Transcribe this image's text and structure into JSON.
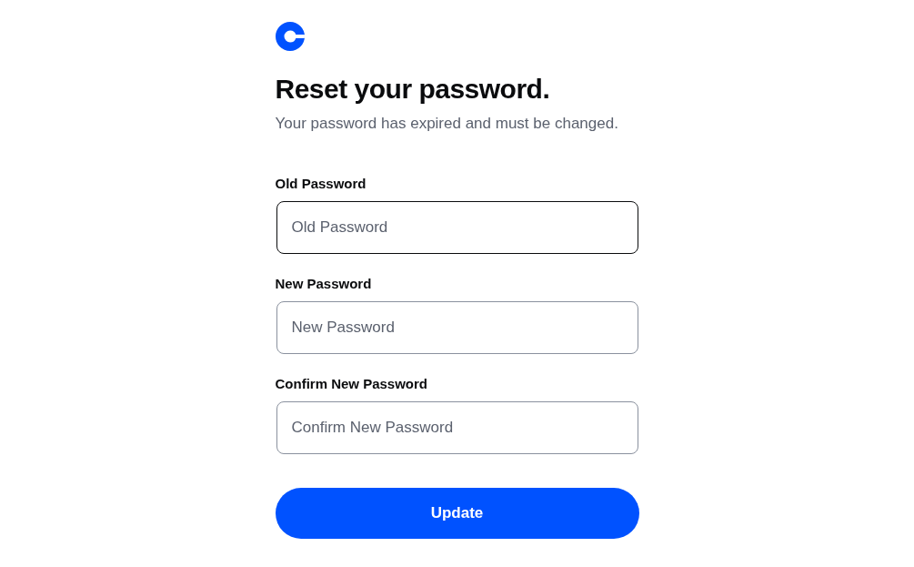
{
  "heading": "Reset your password.",
  "subtitle": "Your password has expired and must be changed.",
  "fields": [
    {
      "label": "Old Password",
      "placeholder": "Old Password",
      "focused": true
    },
    {
      "label": "New Password",
      "placeholder": "New Password",
      "focused": false
    },
    {
      "label": "Confirm New Password",
      "placeholder": "Confirm New Password",
      "focused": false
    }
  ],
  "button": {
    "label": "Update"
  }
}
